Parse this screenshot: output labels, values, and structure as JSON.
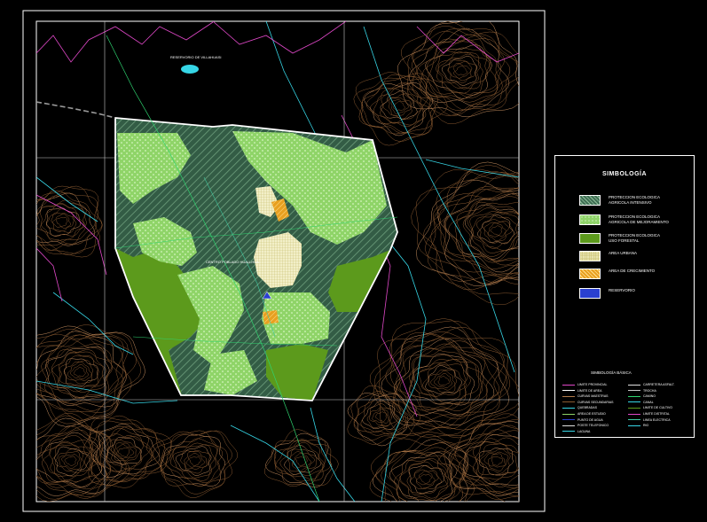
{
  "colors": {
    "background": "#000000",
    "contour": "#b07a4a",
    "river": "#36d6e6",
    "boundary": "#e048c8",
    "grid": "#c8c8c8",
    "zone_intensive": "#3f6e54",
    "zone_moderate": "#8fd468",
    "zone_forestry": "#5c9a1c",
    "zone_urban": "#e8e4b0",
    "zone_expansion": "#e8a020",
    "zone_reservoir": "#2a40d0"
  },
  "map": {
    "labels": {
      "reservoir": "RESERVORIO DE VILLAHUASI",
      "center": "CENTRO POBLADO HUALLHUA"
    }
  },
  "legend": {
    "title": "SIMBOLOGÍA",
    "items": [
      {
        "label": "PROTECCION ECOLOGICA\nAGRICOLA INTENSIVO",
        "pattern": "hatch-dark"
      },
      {
        "label": "PROTECCION ECOLOGICA\nAGRICOLA DE MEJORAMIENTO",
        "pattern": "dots-light"
      },
      {
        "label": "PROTECCION ECOLOGICA\nUSO FORESTAL",
        "pattern": "solid-green"
      },
      {
        "label": "AREA URBANA",
        "pattern": "grid-cream"
      },
      {
        "label": "AREA DE CRECIMIENTO",
        "pattern": "hatch-orange"
      },
      {
        "label": "RESERVORIO",
        "pattern": "solid-blue"
      }
    ],
    "cartographic": {
      "title": "SIMBOLOGÍA BÁSICA",
      "left": [
        {
          "label": "LIMITE PROVINCIAL",
          "color": "#e048c8"
        },
        {
          "label": "LIMITE DE AREA",
          "color": "#ffffff"
        },
        {
          "label": "CURVAS MAESTRAS",
          "color": "#b07a4a"
        },
        {
          "label": "CURVAS SECUNDARIAS",
          "color": "#8a5a30"
        },
        {
          "label": "QUEBRADAS",
          "color": "#36d6e6"
        },
        {
          "label": "AREA DE ESTUDIO",
          "color": "#8fd468"
        },
        {
          "label": "PUNTO DE AGUA",
          "color": "#2a40d0"
        },
        {
          "label": "POSTE TELEFONICO",
          "color": "#e0e0e0"
        },
        {
          "label": "LAGUNA",
          "color": "#36d6e6"
        }
      ],
      "right": [
        {
          "label": "CARRETERA ASFALT.",
          "color": "#e0e0e0"
        },
        {
          "label": "TROCHA",
          "color": "#c8c8c8"
        },
        {
          "label": "CAMINO",
          "color": "#2fd470"
        },
        {
          "label": "CANAL",
          "color": "#36d6e6"
        },
        {
          "label": "LIMITE DE CULTIVO",
          "color": "#5c9a1c"
        },
        {
          "label": "LIMITE DISTRITAL",
          "color": "#e048c8"
        },
        {
          "label": "LINEA ELECTRICA",
          "color": "#40c8a0"
        },
        {
          "label": "RIO",
          "color": "#36d6e6"
        }
      ]
    }
  }
}
